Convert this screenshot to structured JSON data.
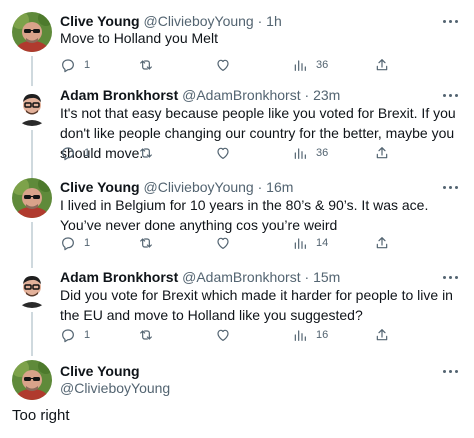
{
  "tweets": [
    {
      "name": "Clive Young",
      "handle": "@ClivieboyYoung",
      "time": "1h",
      "text": "Move to Holland you Melt",
      "replies": "1",
      "retweets": "",
      "likes": "",
      "views": "36"
    },
    {
      "name": "Adam Bronkhorst",
      "handle": "@AdamBronkhorst",
      "time": "23m",
      "text": "It's not that easy because people like you voted for Brexit. If you don't like people changing our country for the better, maybe you should move.",
      "replies": "1",
      "retweets": "",
      "likes": "",
      "views": "36"
    },
    {
      "name": "Clive Young",
      "handle": "@ClivieboyYoung",
      "time": "16m",
      "text": "I lived in Belgium for 10 years in the 80’s & 90’s. It was ace. You’ve never done anything cos you’re weird",
      "replies": "1",
      "retweets": "",
      "likes": "",
      "views": "14"
    },
    {
      "name": "Adam Bronkhorst",
      "handle": "@AdamBronkhorst",
      "time": "15m",
      "text": "Did you vote for Brexit which made it harder for people to live in the EU and move to Holland like you suggested?",
      "replies": "1",
      "retweets": "",
      "likes": "",
      "views": "16"
    }
  ],
  "main_tweet": {
    "name": "Clive Young",
    "handle": "@ClivieboyYoung",
    "text": "Too right"
  },
  "separator": "·",
  "icons": {
    "more": "more-icon",
    "reply": "reply-icon",
    "retweet": "retweet-icon",
    "like": "like-icon",
    "views": "views-icon",
    "share": "share-icon"
  },
  "colors": {
    "text_primary": "#0f1419",
    "text_secondary": "#536471",
    "thread_line": "#cfd9de",
    "background": "#ffffff"
  }
}
